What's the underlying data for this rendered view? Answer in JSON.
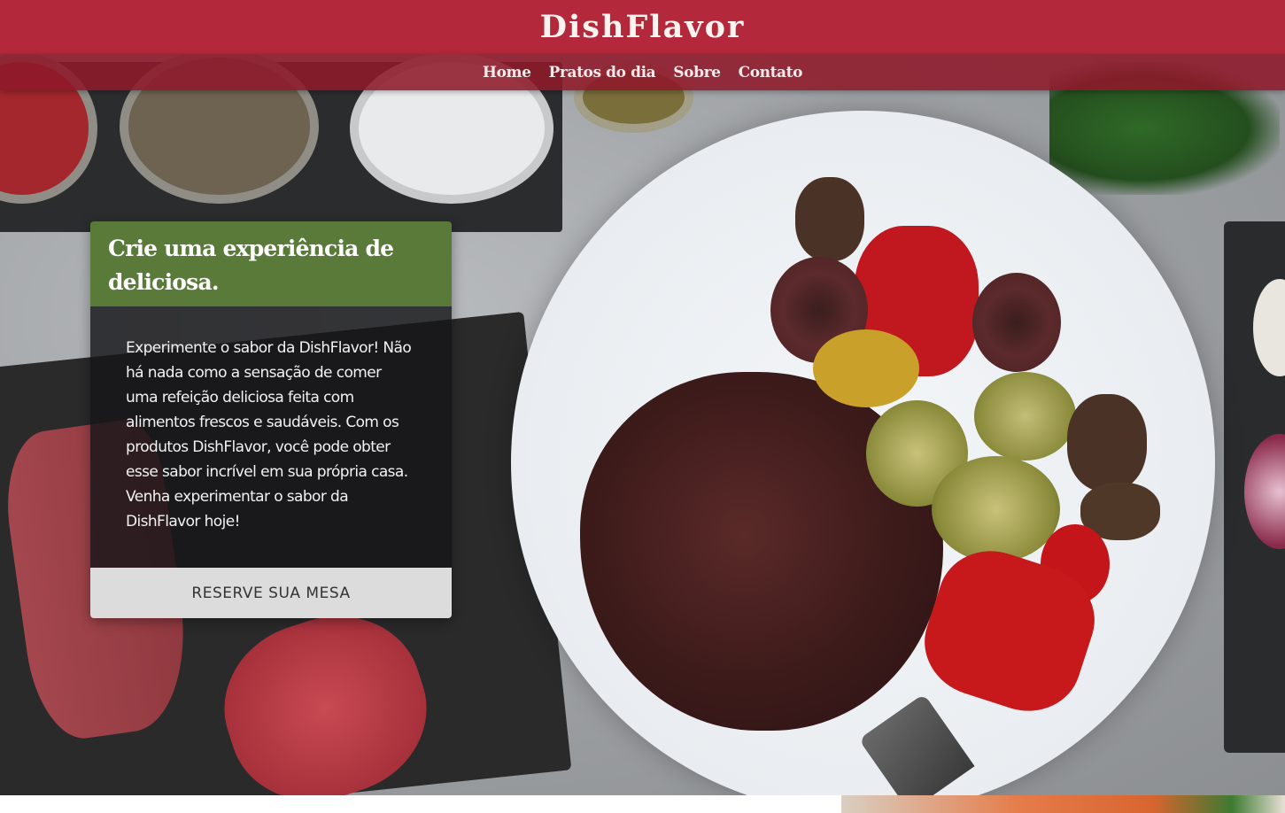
{
  "brand": {
    "name": "DishFlavor",
    "color": "#b3293b"
  },
  "nav": {
    "items": [
      {
        "label": "Home"
      },
      {
        "label": "Pratos do dia"
      },
      {
        "label": "Sobre"
      },
      {
        "label": "Contato"
      }
    ]
  },
  "hero_card": {
    "title": "Crie uma experiência de deliciosa.",
    "body": "Experimente o sabor da DishFlavor! Não há nada como a sensação de comer uma refeição deliciosa feita com alimentos frescos e saudáveis. Com os produtos DishFlavor, você pode obter esse sabor incrível em sua própria casa. Venha experimentar o sabor da DishFlavor hoje!",
    "button_label": "RESERVE SUA MESA",
    "header_color": "#5a7a3a"
  }
}
